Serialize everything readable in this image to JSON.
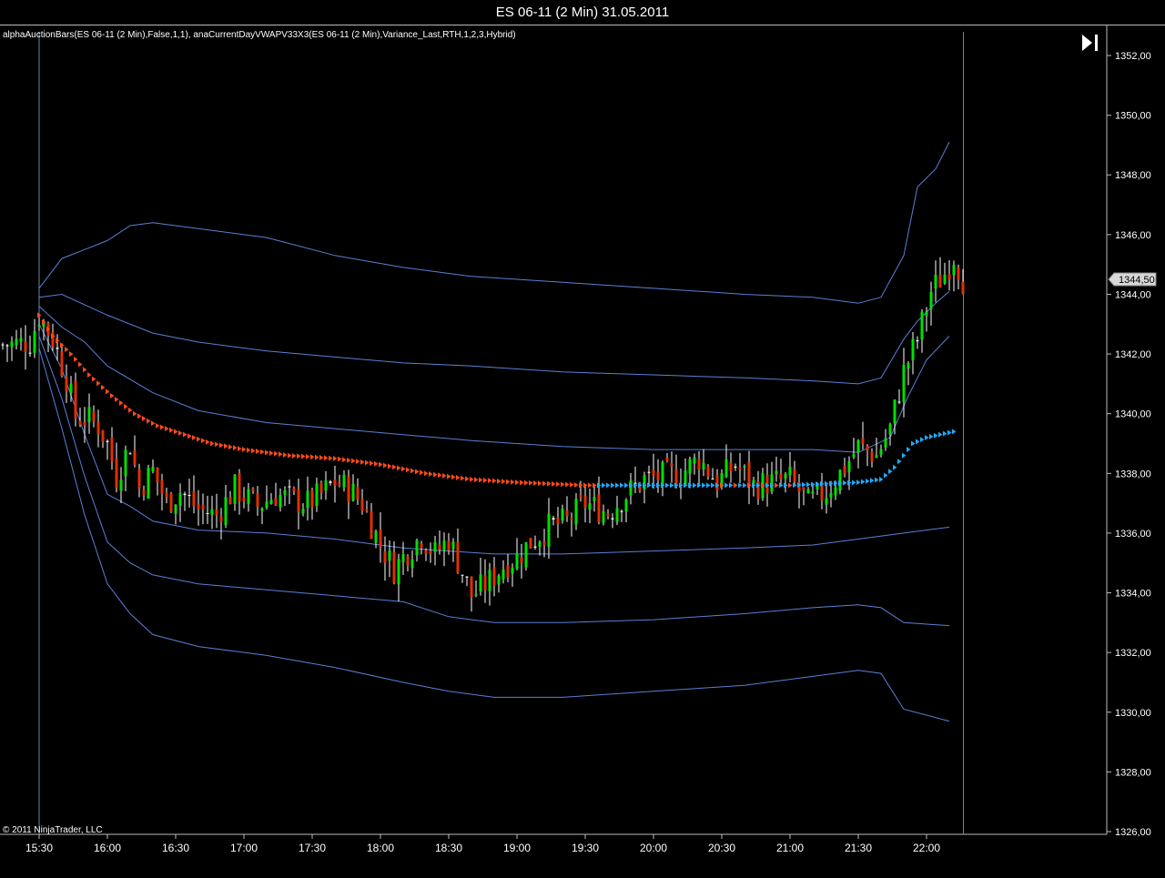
{
  "window": {
    "title": "ES 06-11 (2 Min)  31.05.2011",
    "indicator_label": "alphaAuctionBars(ES 06-11 (2 Min),False,1,1), anaCurrentDayVWAPV33X3(ES 06-11 (2 Min),Variance_Last,RTH,1,2,3,Hybrid)",
    "copyright": "© 2011 NinjaTrader, LLC",
    "last_price_label": "1344,50"
  },
  "colors": {
    "background": "#000000",
    "up_candle": "#00e000",
    "down_candle": "#e03000",
    "neutral_candle": "#ffffff",
    "band": "#5b7fd6",
    "vwap_down": "#ff4a1a",
    "vwap_up": "#1eaaff",
    "axis": "#bbbbbb",
    "session_line": "#6688aa"
  },
  "chart_data": {
    "type": "candlestick",
    "instrument": "ES 06-11",
    "timeframe": "2 Min",
    "date": "31.05.2011",
    "ylim": [
      1326,
      1353
    ],
    "y_ticks": [
      "1326,00",
      "1328,00",
      "1330,00",
      "1332,00",
      "1334,00",
      "1336,00",
      "1338,00",
      "1340,00",
      "1342,00",
      "1344,00",
      "1346,00",
      "1348,00",
      "1350,00",
      "1352,00"
    ],
    "y_tick_values": [
      1326,
      1328,
      1330,
      1332,
      1334,
      1336,
      1338,
      1340,
      1342,
      1344,
      1346,
      1348,
      1350,
      1352
    ],
    "x_ticks": [
      "15:30",
      "16:00",
      "16:30",
      "17:00",
      "17:30",
      "18:00",
      "18:30",
      "19:00",
      "19:30",
      "20:00",
      "20:30",
      "21:00",
      "21:30",
      "22:00"
    ],
    "x_tick_minutes": [
      930,
      960,
      990,
      1020,
      1050,
      1080,
      1110,
      1140,
      1170,
      1200,
      1230,
      1260,
      1290,
      1320
    ],
    "session_start_minute": 930,
    "session_end_minute": 1336,
    "last_price": 1344.5,
    "price_path": [
      [
        914,
        1342.3
      ],
      [
        926,
        1342.4
      ],
      [
        930,
        1343.3
      ],
      [
        936,
        1342.5
      ],
      [
        942,
        1341.2
      ],
      [
        946,
        1339.9
      ],
      [
        952,
        1339.8
      ],
      [
        956,
        1339.6
      ],
      [
        960,
        1339.0
      ],
      [
        964,
        1337.9
      ],
      [
        970,
        1339.0
      ],
      [
        974,
        1337.5
      ],
      [
        980,
        1338.1
      ],
      [
        986,
        1337.0
      ],
      [
        992,
        1337.4
      ],
      [
        1000,
        1336.8
      ],
      [
        1008,
        1336.6
      ],
      [
        1016,
        1337.5
      ],
      [
        1026,
        1336.9
      ],
      [
        1034,
        1337.3
      ],
      [
        1042,
        1337.1
      ],
      [
        1048,
        1337.0
      ],
      [
        1054,
        1337.3
      ],
      [
        1060,
        1337.7
      ],
      [
        1066,
        1337.5
      ],
      [
        1072,
        1337.0
      ],
      [
        1080,
        1335.6
      ],
      [
        1086,
        1334.8
      ],
      [
        1092,
        1335.4
      ],
      [
        1098,
        1335.9
      ],
      [
        1104,
        1335.3
      ],
      [
        1110,
        1335.8
      ],
      [
        1116,
        1334.7
      ],
      [
        1120,
        1333.9
      ],
      [
        1128,
        1334.4
      ],
      [
        1134,
        1334.9
      ],
      [
        1140,
        1335.2
      ],
      [
        1146,
        1335.7
      ],
      [
        1154,
        1336.2
      ],
      [
        1162,
        1336.4
      ],
      [
        1170,
        1337.0
      ],
      [
        1180,
        1336.7
      ],
      [
        1188,
        1337.3
      ],
      [
        1196,
        1337.8
      ],
      [
        1204,
        1337.9
      ],
      [
        1212,
        1338.0
      ],
      [
        1220,
        1338.5
      ],
      [
        1228,
        1337.7
      ],
      [
        1236,
        1338.3
      ],
      [
        1244,
        1337.6
      ],
      [
        1252,
        1337.7
      ],
      [
        1260,
        1337.8
      ],
      [
        1268,
        1337.0
      ],
      [
        1276,
        1337.4
      ],
      [
        1284,
        1338.2
      ],
      [
        1290,
        1338.9
      ],
      [
        1298,
        1338.6
      ],
      [
        1304,
        1339.5
      ],
      [
        1310,
        1341.4
      ],
      [
        1316,
        1342.5
      ],
      [
        1322,
        1344.1
      ],
      [
        1328,
        1344.7
      ],
      [
        1332,
        1345.3
      ],
      [
        1336,
        1344.5
      ]
    ],
    "vwap_path": [
      [
        930,
        1343.3
      ],
      [
        936,
        1342.6
      ],
      [
        944,
        1342.0
      ],
      [
        952,
        1341.3
      ],
      [
        962,
        1340.6
      ],
      [
        972,
        1340.0
      ],
      [
        982,
        1339.6
      ],
      [
        994,
        1339.3
      ],
      [
        1006,
        1339.0
      ],
      [
        1020,
        1338.8
      ],
      [
        1040,
        1338.6
      ],
      [
        1060,
        1338.5
      ],
      [
        1080,
        1338.3
      ],
      [
        1100,
        1338.0
      ],
      [
        1120,
        1337.8
      ],
      [
        1140,
        1337.7
      ],
      [
        1170,
        1337.6
      ],
      [
        1200,
        1337.6
      ],
      [
        1230,
        1337.6
      ],
      [
        1260,
        1337.6
      ],
      [
        1290,
        1337.7
      ],
      [
        1300,
        1337.8
      ],
      [
        1306,
        1338.2
      ],
      [
        1310,
        1338.6
      ],
      [
        1314,
        1339.0
      ],
      [
        1320,
        1339.2
      ],
      [
        1326,
        1339.3
      ],
      [
        1332,
        1339.4
      ]
    ],
    "vwap_color_switch_minute": 1175,
    "vwap_final_switch_minute": 1284,
    "bands": [
      {
        "name": "upper3",
        "path": [
          [
            930,
            1344.2
          ],
          [
            940,
            1345.2
          ],
          [
            950,
            1345.5
          ],
          [
            960,
            1345.8
          ],
          [
            970,
            1346.3
          ],
          [
            980,
            1346.4
          ],
          [
            1000,
            1346.2
          ],
          [
            1030,
            1345.9
          ],
          [
            1060,
            1345.3
          ],
          [
            1090,
            1344.9
          ],
          [
            1120,
            1344.6
          ],
          [
            1160,
            1344.4
          ],
          [
            1200,
            1344.2
          ],
          [
            1240,
            1344.0
          ],
          [
            1270,
            1343.9
          ],
          [
            1290,
            1343.7
          ],
          [
            1300,
            1343.9
          ],
          [
            1310,
            1345.3
          ],
          [
            1316,
            1347.6
          ],
          [
            1324,
            1348.2
          ],
          [
            1330,
            1349.1
          ]
        ]
      },
      {
        "name": "upper2",
        "path": [
          [
            930,
            1343.9
          ],
          [
            940,
            1344.0
          ],
          [
            960,
            1343.3
          ],
          [
            980,
            1342.7
          ],
          [
            1000,
            1342.4
          ],
          [
            1030,
            1342.1
          ],
          [
            1060,
            1341.9
          ],
          [
            1090,
            1341.7
          ],
          [
            1120,
            1341.6
          ],
          [
            1160,
            1341.4
          ],
          [
            1200,
            1341.3
          ],
          [
            1240,
            1341.2
          ],
          [
            1270,
            1341.1
          ],
          [
            1290,
            1341.0
          ],
          [
            1300,
            1341.2
          ],
          [
            1310,
            1342.5
          ],
          [
            1316,
            1343.1
          ],
          [
            1324,
            1343.7
          ],
          [
            1330,
            1344.1
          ]
        ]
      },
      {
        "name": "upper1",
        "path": [
          [
            930,
            1343.6
          ],
          [
            940,
            1342.9
          ],
          [
            950,
            1342.4
          ],
          [
            960,
            1341.6
          ],
          [
            980,
            1340.7
          ],
          [
            1000,
            1340.1
          ],
          [
            1030,
            1339.7
          ],
          [
            1060,
            1339.5
          ],
          [
            1090,
            1339.3
          ],
          [
            1120,
            1339.1
          ],
          [
            1160,
            1338.9
          ],
          [
            1200,
            1338.8
          ],
          [
            1240,
            1338.8
          ],
          [
            1270,
            1338.8
          ],
          [
            1290,
            1338.7
          ],
          [
            1304,
            1339.2
          ],
          [
            1312,
            1340.6
          ],
          [
            1320,
            1341.8
          ],
          [
            1330,
            1342.6
          ]
        ]
      },
      {
        "name": "lower1",
        "path": [
          [
            930,
            1343.0
          ],
          [
            940,
            1341.5
          ],
          [
            950,
            1339.3
          ],
          [
            960,
            1337.3
          ],
          [
            970,
            1336.9
          ],
          [
            980,
            1336.4
          ],
          [
            1000,
            1336.1
          ],
          [
            1030,
            1336.0
          ],
          [
            1060,
            1335.8
          ],
          [
            1090,
            1335.5
          ],
          [
            1110,
            1335.4
          ],
          [
            1130,
            1335.3
          ],
          [
            1160,
            1335.3
          ],
          [
            1200,
            1335.4
          ],
          [
            1240,
            1335.5
          ],
          [
            1270,
            1335.6
          ],
          [
            1290,
            1335.8
          ],
          [
            1310,
            1336.0
          ],
          [
            1330,
            1336.2
          ]
        ]
      },
      {
        "name": "lower2",
        "path": [
          [
            930,
            1342.6
          ],
          [
            940,
            1340.5
          ],
          [
            950,
            1337.9
          ],
          [
            960,
            1335.7
          ],
          [
            970,
            1335.0
          ],
          [
            980,
            1334.6
          ],
          [
            1000,
            1334.3
          ],
          [
            1030,
            1334.1
          ],
          [
            1060,
            1333.9
          ],
          [
            1090,
            1333.7
          ],
          [
            1110,
            1333.2
          ],
          [
            1130,
            1333.0
          ],
          [
            1160,
            1333.0
          ],
          [
            1200,
            1333.1
          ],
          [
            1240,
            1333.3
          ],
          [
            1270,
            1333.5
          ],
          [
            1290,
            1333.6
          ],
          [
            1300,
            1333.5
          ],
          [
            1310,
            1333.0
          ],
          [
            1330,
            1332.9
          ]
        ]
      },
      {
        "name": "lower3",
        "path": [
          [
            930,
            1342.2
          ],
          [
            940,
            1339.5
          ],
          [
            950,
            1336.6
          ],
          [
            960,
            1334.3
          ],
          [
            970,
            1333.3
          ],
          [
            980,
            1332.6
          ],
          [
            1000,
            1332.2
          ],
          [
            1030,
            1331.9
          ],
          [
            1060,
            1331.5
          ],
          [
            1090,
            1331.0
          ],
          [
            1110,
            1330.7
          ],
          [
            1130,
            1330.5
          ],
          [
            1160,
            1330.5
          ],
          [
            1200,
            1330.7
          ],
          [
            1240,
            1330.9
          ],
          [
            1270,
            1331.2
          ],
          [
            1290,
            1331.4
          ],
          [
            1300,
            1331.3
          ],
          [
            1310,
            1330.1
          ],
          [
            1330,
            1329.7
          ]
        ]
      }
    ]
  }
}
